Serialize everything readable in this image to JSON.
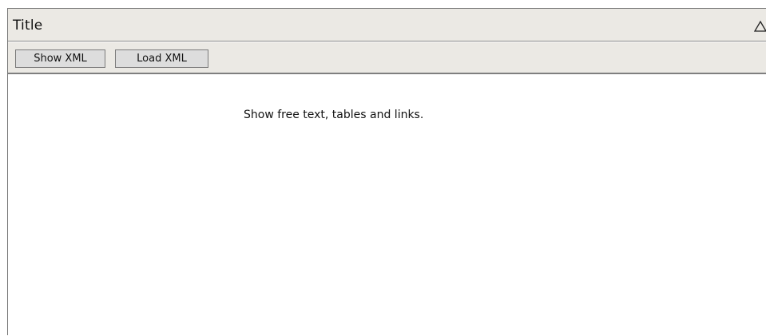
{
  "window": {
    "title": "Title",
    "collapse_icon": "triangle-up-outline-icon"
  },
  "toolbar": {
    "show_xml_label": "Show XML",
    "load_xml_label": "Load XML"
  },
  "content": {
    "text": "Show free text, tables and links."
  },
  "colors": {
    "chrome_background": "#ebe9e4",
    "button_background": "#dddddd",
    "border": "#7a7a7a",
    "content_background": "#ffffff"
  }
}
